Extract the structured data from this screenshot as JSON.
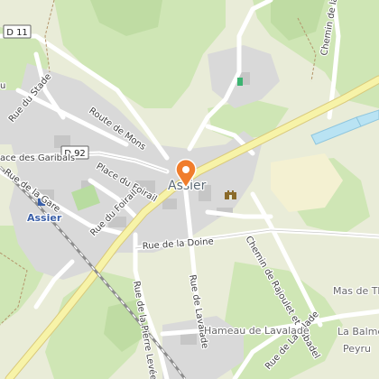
{
  "map": {
    "town": "Assier",
    "station": "Assier",
    "hamlets": [
      "Hameau de Lavalade",
      "Mas de Th",
      "La Balme",
      "Peyru"
    ],
    "roads": {
      "d11": "D 11",
      "d92": "D 92",
      "route_de_mons": "Route de Mons",
      "place_du_foirail": "Place du Foirail",
      "rue_du_foirail": "Rue du Foirail",
      "rue_de_la_gare": "Rue de la Gare",
      "ace_des_garibals": "ace des Garibals",
      "rue_du_stade": "Rue du Stade",
      "rue_de_la_doine": "Rue de la Doine",
      "rue_de_lavalade": "Rue de Lavalade",
      "rue_de_la_pierre_levee": "Rue de la Pierre Levée",
      "chemin_de_rajoulet": "Chemin de Rajoulet et Sabadel",
      "chemin_de_la_fo": "Chemin de la Fo",
      "rue_de_lavalade_2": "Rue de Lavalade",
      "partial_rue": "u"
    },
    "marker": {
      "icon": "location-pin-icon",
      "color": "#f07d2c"
    },
    "poi": {
      "icon": "castle-icon",
      "color": "#8a6a2a"
    },
    "colors": {
      "background": "#e9ecd8",
      "forest": "#cfe6b5",
      "built": "#d9d9d9",
      "road": "#ffffff",
      "main_road": "#f7f3a8",
      "water": "#b9e3f3",
      "railway": "#8c8c8c"
    }
  }
}
